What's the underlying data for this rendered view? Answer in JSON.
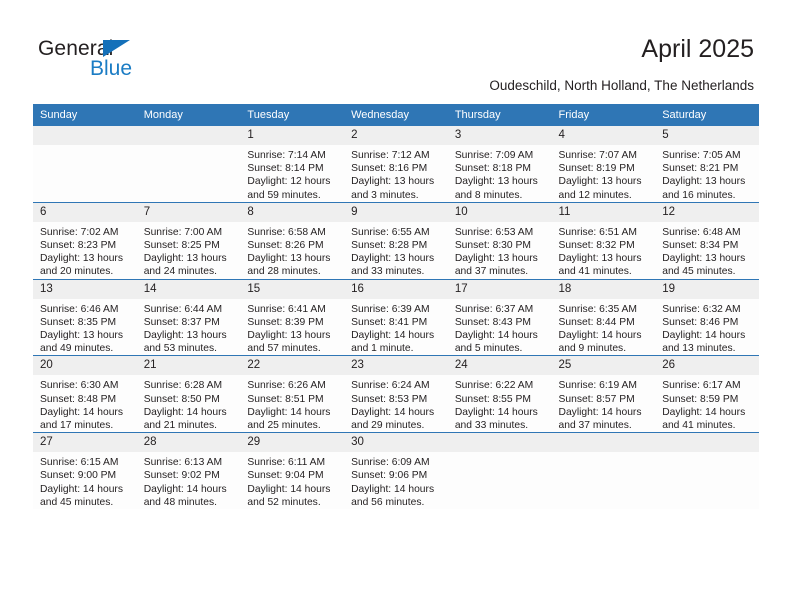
{
  "brand": {
    "name_top": "General",
    "name_bottom": "Blue",
    "accent_color": "#1b7cc4",
    "triangle_color": "#1470b9"
  },
  "header": {
    "title": "April 2025",
    "subtitle": "Oudeschild, North Holland, The Netherlands"
  },
  "theme": {
    "header_blue": "#2f76b5",
    "daynum_gray": "#efefef",
    "text_color": "#231f20"
  },
  "weekday_headers": [
    "Sunday",
    "Monday",
    "Tuesday",
    "Wednesday",
    "Thursday",
    "Friday",
    "Saturday"
  ],
  "weeks": [
    [
      {
        "day": "",
        "blank": true
      },
      {
        "day": "",
        "blank": true
      },
      {
        "day": "1",
        "sunrise": "Sunrise: 7:14 AM",
        "sunset": "Sunset: 8:14 PM",
        "daylight_1": "Daylight: 12 hours",
        "daylight_2": "and 59 minutes."
      },
      {
        "day": "2",
        "sunrise": "Sunrise: 7:12 AM",
        "sunset": "Sunset: 8:16 PM",
        "daylight_1": "Daylight: 13 hours",
        "daylight_2": "and 3 minutes."
      },
      {
        "day": "3",
        "sunrise": "Sunrise: 7:09 AM",
        "sunset": "Sunset: 8:18 PM",
        "daylight_1": "Daylight: 13 hours",
        "daylight_2": "and 8 minutes."
      },
      {
        "day": "4",
        "sunrise": "Sunrise: 7:07 AM",
        "sunset": "Sunset: 8:19 PM",
        "daylight_1": "Daylight: 13 hours",
        "daylight_2": "and 12 minutes."
      },
      {
        "day": "5",
        "sunrise": "Sunrise: 7:05 AM",
        "sunset": "Sunset: 8:21 PM",
        "daylight_1": "Daylight: 13 hours",
        "daylight_2": "and 16 minutes."
      }
    ],
    [
      {
        "day": "6",
        "sunrise": "Sunrise: 7:02 AM",
        "sunset": "Sunset: 8:23 PM",
        "daylight_1": "Daylight: 13 hours",
        "daylight_2": "and 20 minutes."
      },
      {
        "day": "7",
        "sunrise": "Sunrise: 7:00 AM",
        "sunset": "Sunset: 8:25 PM",
        "daylight_1": "Daylight: 13 hours",
        "daylight_2": "and 24 minutes."
      },
      {
        "day": "8",
        "sunrise": "Sunrise: 6:58 AM",
        "sunset": "Sunset: 8:26 PM",
        "daylight_1": "Daylight: 13 hours",
        "daylight_2": "and 28 minutes."
      },
      {
        "day": "9",
        "sunrise": "Sunrise: 6:55 AM",
        "sunset": "Sunset: 8:28 PM",
        "daylight_1": "Daylight: 13 hours",
        "daylight_2": "and 33 minutes."
      },
      {
        "day": "10",
        "sunrise": "Sunrise: 6:53 AM",
        "sunset": "Sunset: 8:30 PM",
        "daylight_1": "Daylight: 13 hours",
        "daylight_2": "and 37 minutes."
      },
      {
        "day": "11",
        "sunrise": "Sunrise: 6:51 AM",
        "sunset": "Sunset: 8:32 PM",
        "daylight_1": "Daylight: 13 hours",
        "daylight_2": "and 41 minutes."
      },
      {
        "day": "12",
        "sunrise": "Sunrise: 6:48 AM",
        "sunset": "Sunset: 8:34 PM",
        "daylight_1": "Daylight: 13 hours",
        "daylight_2": "and 45 minutes."
      }
    ],
    [
      {
        "day": "13",
        "sunrise": "Sunrise: 6:46 AM",
        "sunset": "Sunset: 8:35 PM",
        "daylight_1": "Daylight: 13 hours",
        "daylight_2": "and 49 minutes."
      },
      {
        "day": "14",
        "sunrise": "Sunrise: 6:44 AM",
        "sunset": "Sunset: 8:37 PM",
        "daylight_1": "Daylight: 13 hours",
        "daylight_2": "and 53 minutes."
      },
      {
        "day": "15",
        "sunrise": "Sunrise: 6:41 AM",
        "sunset": "Sunset: 8:39 PM",
        "daylight_1": "Daylight: 13 hours",
        "daylight_2": "and 57 minutes."
      },
      {
        "day": "16",
        "sunrise": "Sunrise: 6:39 AM",
        "sunset": "Sunset: 8:41 PM",
        "daylight_1": "Daylight: 14 hours",
        "daylight_2": "and 1 minute."
      },
      {
        "day": "17",
        "sunrise": "Sunrise: 6:37 AM",
        "sunset": "Sunset: 8:43 PM",
        "daylight_1": "Daylight: 14 hours",
        "daylight_2": "and 5 minutes."
      },
      {
        "day": "18",
        "sunrise": "Sunrise: 6:35 AM",
        "sunset": "Sunset: 8:44 PM",
        "daylight_1": "Daylight: 14 hours",
        "daylight_2": "and 9 minutes."
      },
      {
        "day": "19",
        "sunrise": "Sunrise: 6:32 AM",
        "sunset": "Sunset: 8:46 PM",
        "daylight_1": "Daylight: 14 hours",
        "daylight_2": "and 13 minutes."
      }
    ],
    [
      {
        "day": "20",
        "sunrise": "Sunrise: 6:30 AM",
        "sunset": "Sunset: 8:48 PM",
        "daylight_1": "Daylight: 14 hours",
        "daylight_2": "and 17 minutes."
      },
      {
        "day": "21",
        "sunrise": "Sunrise: 6:28 AM",
        "sunset": "Sunset: 8:50 PM",
        "daylight_1": "Daylight: 14 hours",
        "daylight_2": "and 21 minutes."
      },
      {
        "day": "22",
        "sunrise": "Sunrise: 6:26 AM",
        "sunset": "Sunset: 8:51 PM",
        "daylight_1": "Daylight: 14 hours",
        "daylight_2": "and 25 minutes."
      },
      {
        "day": "23",
        "sunrise": "Sunrise: 6:24 AM",
        "sunset": "Sunset: 8:53 PM",
        "daylight_1": "Daylight: 14 hours",
        "daylight_2": "and 29 minutes."
      },
      {
        "day": "24",
        "sunrise": "Sunrise: 6:22 AM",
        "sunset": "Sunset: 8:55 PM",
        "daylight_1": "Daylight: 14 hours",
        "daylight_2": "and 33 minutes."
      },
      {
        "day": "25",
        "sunrise": "Sunrise: 6:19 AM",
        "sunset": "Sunset: 8:57 PM",
        "daylight_1": "Daylight: 14 hours",
        "daylight_2": "and 37 minutes."
      },
      {
        "day": "26",
        "sunrise": "Sunrise: 6:17 AM",
        "sunset": "Sunset: 8:59 PM",
        "daylight_1": "Daylight: 14 hours",
        "daylight_2": "and 41 minutes."
      }
    ],
    [
      {
        "day": "27",
        "sunrise": "Sunrise: 6:15 AM",
        "sunset": "Sunset: 9:00 PM",
        "daylight_1": "Daylight: 14 hours",
        "daylight_2": "and 45 minutes."
      },
      {
        "day": "28",
        "sunrise": "Sunrise: 6:13 AM",
        "sunset": "Sunset: 9:02 PM",
        "daylight_1": "Daylight: 14 hours",
        "daylight_2": "and 48 minutes."
      },
      {
        "day": "29",
        "sunrise": "Sunrise: 6:11 AM",
        "sunset": "Sunset: 9:04 PM",
        "daylight_1": "Daylight: 14 hours",
        "daylight_2": "and 52 minutes."
      },
      {
        "day": "30",
        "sunrise": "Sunrise: 6:09 AM",
        "sunset": "Sunset: 9:06 PM",
        "daylight_1": "Daylight: 14 hours",
        "daylight_2": "and 56 minutes."
      },
      {
        "day": "",
        "blank": true
      },
      {
        "day": "",
        "blank": true
      },
      {
        "day": "",
        "blank": true
      }
    ]
  ]
}
